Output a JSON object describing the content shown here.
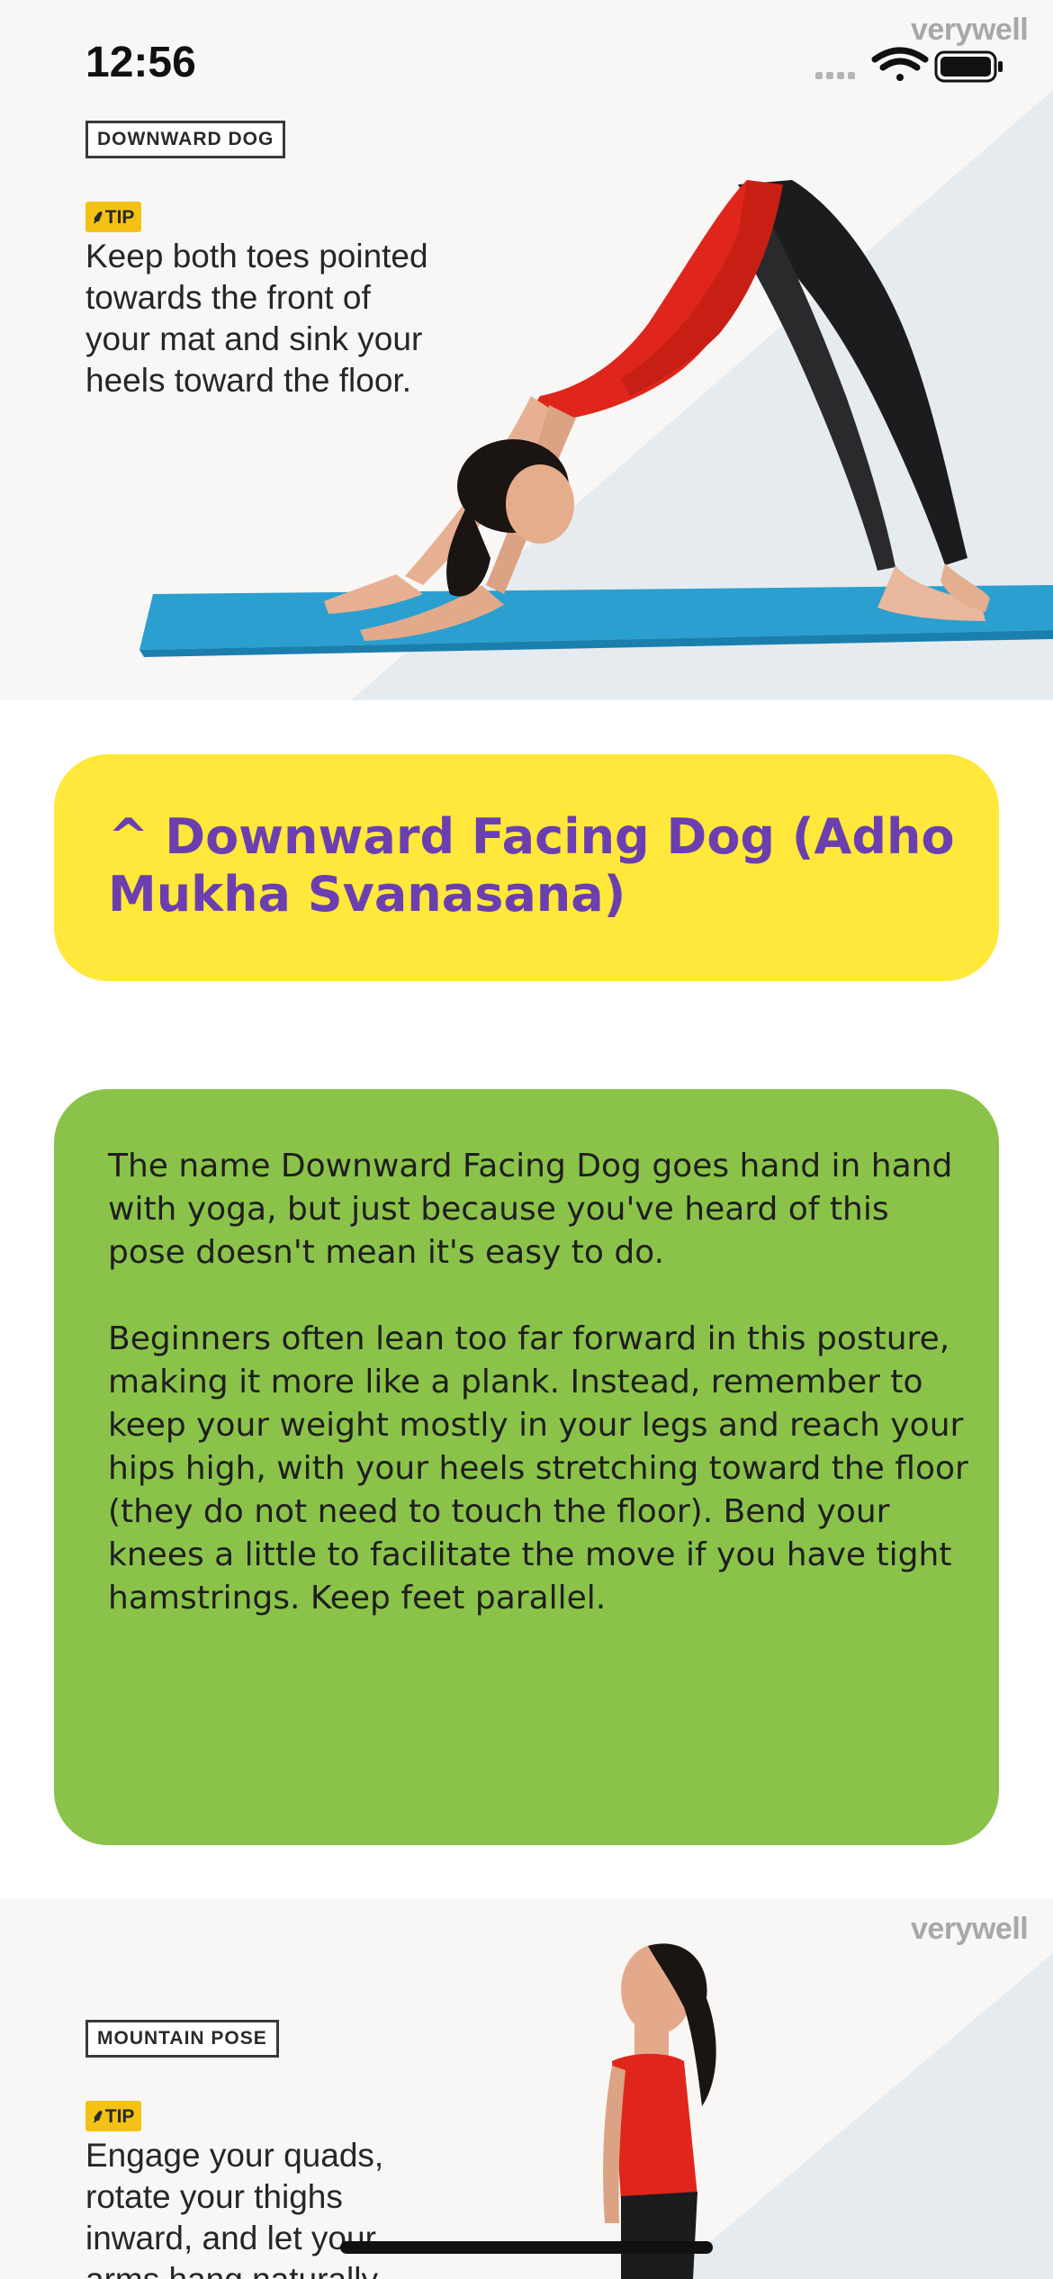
{
  "status_bar": {
    "time": "12:56"
  },
  "hero_top": {
    "brand": "verywell",
    "pose_label": "DOWNWARD DOG",
    "tip_label": "TIP",
    "tip_text": "Keep both toes pointed\ntowards the front of\nyour mat and sink your\nheels toward the floor."
  },
  "pose_card": {
    "toggle_icon": "^",
    "title": "Downward Facing Dog (Adho Mukha Svanasana)"
  },
  "description": {
    "text": "The name Downward Facing Dog goes hand in hand with yoga, but just because you've heard of this pose doesn't mean it's easy to do.\n\nBeginners often lean too far forward in this posture, making it more like a plank. Instead, remember to keep your weight mostly in your legs and reach your hips high, with your heels stretching toward the floor (they do not need to touch the floor). Bend your knees a little to facilitate the move if you have tight hamstrings. Keep feet parallel."
  },
  "hero_bottom": {
    "brand": "verywell",
    "pose_label": "MOUNTAIN POSE",
    "tip_label": "TIP",
    "tip_text": "Engage your quads,\nrotate your thighs\ninward, and let your\narms hang naturally"
  },
  "colors": {
    "title_card_bg": "#ffe83a",
    "title_text": "#6b3fb0",
    "desc_card_bg": "#8bc34a",
    "shirt": "#e0261c",
    "mat": "#2a9fd0",
    "tip_badge": "#f4c215"
  },
  "icons": {
    "signal": "cellular-signal-icon",
    "wifi": "wifi-icon",
    "battery": "battery-icon",
    "tip": "leaf-icon",
    "toggle": "caret-up-icon"
  }
}
